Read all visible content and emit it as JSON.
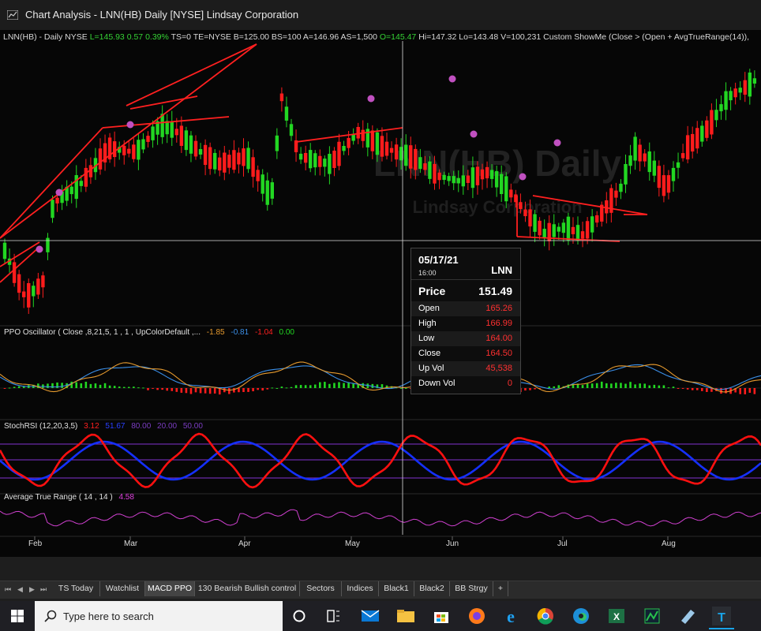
{
  "window": {
    "title": "Chart Analysis - LNN(HB) Daily [NYSE] Lindsay Corporation"
  },
  "price_header": {
    "prefix": "LNN(HB) - Daily  NYSE",
    "last": "L=145.93",
    "change": "0.57",
    "change_pct": "0.39%",
    "mid": "TS=0  TE=NYSE  B=125.00  BS=100  A=146.96  AS=1,500",
    "open": "O=145.47",
    "rest": "Hi=147.32  Lo=143.48  V=100,231  Custom ShowMe (Close > (Open + AvgTrueRange(14)),"
  },
  "watermark": {
    "symbol": "LNN(HB) Daily",
    "company": "Lindsay Corporation"
  },
  "indicators": {
    "ppo": {
      "label": "PPO Oscillator ( Close ,8,21,5, 1 , 1 , UpColorDefault ,...",
      "v1": "-1.85",
      "v2": "-0.81",
      "v3": "-1.04",
      "v4": "0.00"
    },
    "stoch": {
      "label": "StochRSI (12,20,3,5)",
      "v1": "3.12",
      "v2": "51.67",
      "v3": "80.00",
      "v4": "20.00",
      "v5": "50.00"
    },
    "atr": {
      "label": "Average True Range ( 14 , 14 )",
      "v1": "4.58"
    }
  },
  "tooltip": {
    "date": "05/17/21",
    "time": "16:00",
    "symbol": "LNN",
    "price_label": "Price",
    "price": "151.49",
    "rows": [
      {
        "k": "Open",
        "v": "165.26"
      },
      {
        "k": "High",
        "v": "166.99"
      },
      {
        "k": "Low",
        "v": "164.00"
      },
      {
        "k": "Close",
        "v": "164.50"
      },
      {
        "k": "Up Vol",
        "v": "45,538"
      },
      {
        "k": "Down Vol",
        "v": "0"
      }
    ]
  },
  "x_axis": [
    "Feb",
    "Mar",
    "Apr",
    "May",
    "Jun",
    "Jul",
    "Aug"
  ],
  "tabs": [
    "TS Today",
    "Watchlist",
    "MACD PPO",
    "130 Bearish Bullish control",
    "Sectors",
    "Indices",
    "Black1",
    "Black2",
    "BB Strgy",
    "+"
  ],
  "active_tab": "MACD PPO",
  "taskbar": {
    "search_placeholder": "Type here to search"
  },
  "colors": {
    "up": "#22d722",
    "down": "#ff1c1c",
    "trend": "#ff2020",
    "ppo_blue": "#3b8fe8",
    "ppo_orange": "#e69a2e",
    "stoch_fast": "#ff1010",
    "stoch_slow": "#1530ff",
    "atr": "#d040d0",
    "signal": "#c050c0"
  },
  "chart_data": {
    "type": "candlestick",
    "symbol": "LNN(HB)",
    "interval": "Daily",
    "x_labels": [
      "Feb",
      "Mar",
      "Apr",
      "May",
      "Jun",
      "Jul",
      "Aug"
    ],
    "tooltip_bar": {
      "date": "05/17/21",
      "open": 165.26,
      "high": 166.99,
      "low": 164.0,
      "close": 164.5,
      "up_vol": 45538,
      "down_vol": 0
    },
    "last": {
      "close": 145.93,
      "open": 145.47,
      "high": 147.32,
      "low": 143.48,
      "volume": 100231,
      "bid": 125.0,
      "ask": 146.96
    },
    "indicator_values": {
      "ppo": [
        -1.85,
        -0.81,
        -1.04,
        0.0
      ],
      "stochrsi": [
        3.12,
        51.67,
        80.0,
        20.0,
        50.0
      ],
      "atr": 4.58
    }
  }
}
